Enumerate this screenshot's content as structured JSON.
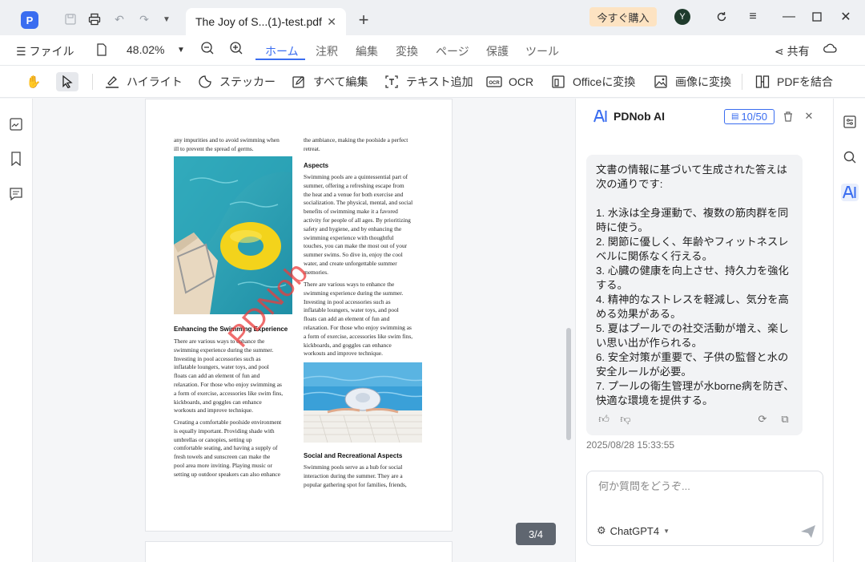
{
  "titlebar": {
    "app_logo": "P",
    "tab_title": "The Joy of S...(1)-test.pdf",
    "tab_close": "✕",
    "new_tab": "+",
    "buy_label": "今すぐ購入",
    "avatar_initial": "Y"
  },
  "menubar": {
    "file_label": "ファイル",
    "zoom": "48.02%",
    "tabs": [
      "ホーム",
      "注釈",
      "編集",
      "変換",
      "ページ",
      "保護",
      "ツール"
    ],
    "share_label": "共有"
  },
  "toolbar": {
    "highlight": "ハイライト",
    "sticker": "ステッカー",
    "edit_all": "すべて編集",
    "add_text": "テキスト追加",
    "ocr": "OCR",
    "to_office": "Officeに変換",
    "to_image": "画像に変換",
    "merge_pdf": "PDFを結合"
  },
  "document": {
    "col1_top": "any impurities and to avoid swimming when\nill to prevent the spread of germs.",
    "col1_heading": "Enhancing the Swimming Experience",
    "col1_para1": "There are various ways to enhance the\nswimming experience during the summer.\nInvesting in pool accessories such as\ninflatable loungers, water toys, and pool\nfloats can add an element of fun and\nrelaxation. For those who enjoy swimming as\na form of exercise, accessories like swim fins,\nkickboards, and goggles can enhance\nworkouts and improve technique.",
    "col1_para2": "Creating a comfortable poolside environment\nis equally important. Providing shade with\numbrellas or canopies, setting up\ncomfortable seating, and having a supply of\nfresh towels and sunscreen can make the\npool area more inviting. Playing music or\nsetting up outdoor speakers can also enhance",
    "col2_top": "the ambiance, making the poolside a perfect\nretreat.",
    "col2_heading1": "Aspects",
    "col2_para1": "Swimming pools are a quintessential part of\nsummer, offering a refreshing escape from\nthe heat and a venue for both exercise and\nsocialization. The physical, mental, and social\nbenefits of swimming make it a favored\nactivity for people of all ages. By prioritizing\nsafety and hygiene, and by enhancing the\nswimming experience with thoughtful\ntouches, you can make the most out of your\nsummer swims. So dive in, enjoy the cool\nwater, and create unforgettable summer\nmemories.",
    "col2_para2": "There are various ways to enhance the\nswimming experience during the summer.\nInvesting in pool accessories such as\ninflatable loungers, water toys, and pool\nfloats can add an element of fun and\nrelaxation. For those who enjoy swimming as\na form of exercise, accessories like swim fins,\nkickboards, and goggles can enhance\nworkouts and improve technique.",
    "col2_heading2": "Social and Recreational Aspects",
    "col2_para3": "Swimming pools serve as a hub for social\ninteraction during the summer. They are a\npopular gathering spot for families, friends,",
    "watermark": "PDNob",
    "page_indicator": "3/4"
  },
  "ai_panel": {
    "title": "PDNob AI",
    "quota": "10/50",
    "answer": "文書の情報に基づいて生成された答えは次の通りです:\n\n1. 水泳は全身運動で、複数の筋肉群を同時に使う。\n2. 関節に優しく、年齢やフィットネスレベルに関係なく行える。\n3. 心臓の健康を向上させ、持久力を強化する。\n4. 精神的なストレスを軽減し、気分を高める効果がある。\n5. 夏はプールでの社交活動が増え、楽しい思い出が作られる。\n6. 安全対策が重要で、子供の監督と水の安全ルールが必要。\n7. プールの衛生管理が水borne病を防ぎ、快適な環境を提供する。",
    "timestamp": "2025/08/28 15:33:55",
    "input_placeholder": "何か質問をどうぞ...",
    "model": "ChatGPT4"
  }
}
